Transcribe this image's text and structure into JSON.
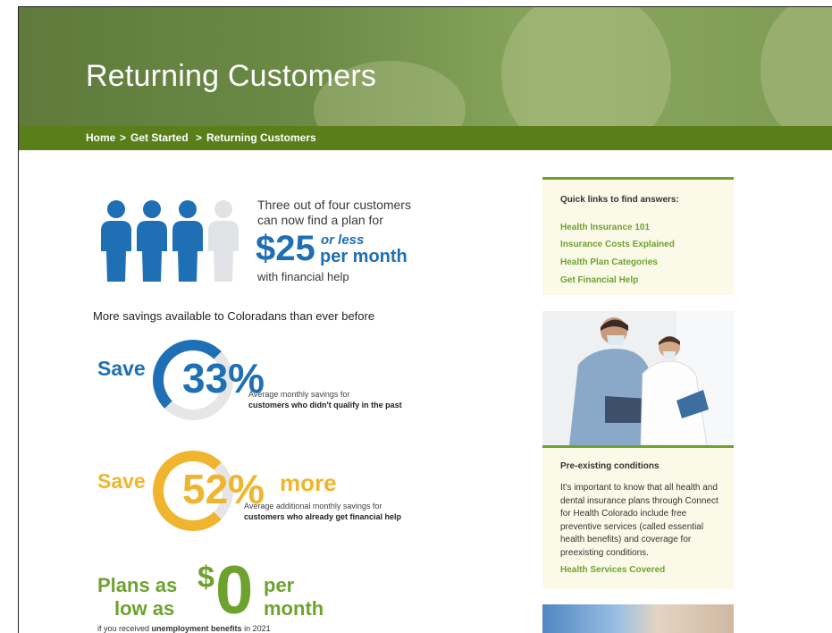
{
  "hero": {
    "title": "Returning Customers"
  },
  "breadcrumb": [
    "Home",
    "Get Started",
    "Returning Customers"
  ],
  "breadcrumb_separator": ">",
  "infographic": {
    "intro_line1": "Three out of four customers",
    "intro_line2": "can now find a plan for",
    "price": "$25",
    "or_less": "or less",
    "per_month": "per month",
    "with_help": "with financial help",
    "savings_heading": "More savings available to Coloradans than ever before",
    "save1": {
      "save": "Save",
      "pct": "33%",
      "cap1": "Average monthly savings for",
      "cap2": "customers who didn't qualify in the past"
    },
    "save2": {
      "save": "Save",
      "pct": "52%",
      "more": "more",
      "cap1": "Average additional monthly savings for",
      "cap2": "customers who already get financial help"
    },
    "plans": {
      "plans_as": "Plans as",
      "low_as": "low as",
      "dollar": "$",
      "zero": "0",
      "per": "per",
      "month": "month",
      "footnote_pre": "if you received",
      "footnote_bold": "unemployment benefits",
      "footnote_post": "in 2021"
    }
  },
  "quick_links": {
    "title": "Quick links to find answers:",
    "links": [
      "Health Insurance 101",
      "Insurance Costs Explained",
      "Health Plan Categories",
      "Get Financial Help"
    ]
  },
  "preexisting": {
    "title": "Pre-existing conditions",
    "body": "It's important to know that all health and dental insurance plans through Connect for Health Colorado include free preventive services (called essential health benefits) and coverage for preexisting conditions.",
    "link": "Health Services Covered"
  },
  "colors": {
    "green": "#6ea22f",
    "dark_green": "#5a7f1a",
    "blue": "#1f6fb4",
    "gold": "#f0b52e",
    "cream": "#fbfae9"
  }
}
